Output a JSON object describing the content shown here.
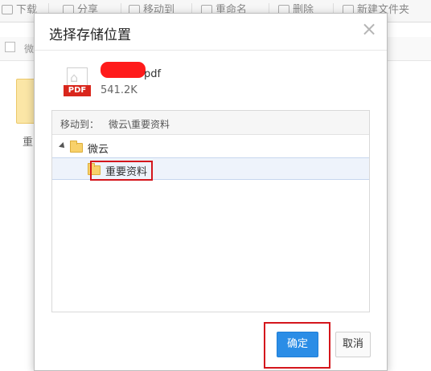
{
  "toolbar": {
    "items": [
      {
        "label": "下载",
        "icon": "download-icon"
      },
      {
        "label": "分享",
        "icon": "share-icon"
      },
      {
        "label": "移动到",
        "icon": "move-icon"
      },
      {
        "label": "重命名",
        "icon": "rename-icon"
      },
      {
        "label": "删除",
        "icon": "delete-icon"
      },
      {
        "label": "新建文件夹",
        "icon": "new-folder-icon"
      }
    ]
  },
  "background": {
    "breadcrumb": "微",
    "folder_label": "重"
  },
  "dialog": {
    "title": "选择存储位置",
    "close_glyph": "×",
    "file": {
      "icon_tag": "PDF",
      "name_suffix": "pdf",
      "size": "541.2K"
    },
    "tree": {
      "header_label": "移动到：",
      "header_path": "微云\\重要资料",
      "root": {
        "label": "微云",
        "expanded": true
      },
      "children": [
        {
          "label": "重要资料",
          "selected": true
        }
      ]
    },
    "buttons": {
      "ok": "确定",
      "cancel": "取消"
    }
  },
  "colors": {
    "accent": "#2b8de6",
    "highlight": "#d4161c",
    "pdf_tag": "#d9261c",
    "folder": "#f8d16a"
  }
}
